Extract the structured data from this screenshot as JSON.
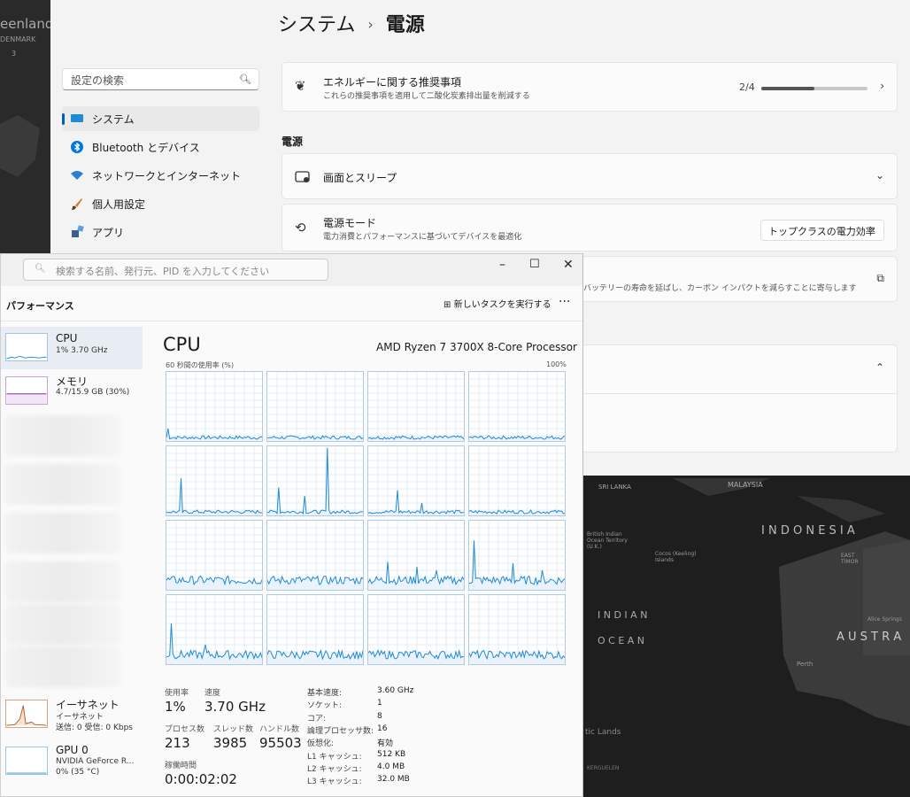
{
  "settings": {
    "breadcrumb_parent": "システム",
    "breadcrumb_current": "電源",
    "search_placeholder": "設定の検索",
    "nav": [
      {
        "label": "システム",
        "icon": "monitor-icon",
        "selected": true
      },
      {
        "label": "Bluetooth とデバイス",
        "icon": "bluetooth-icon"
      },
      {
        "label": "ネットワークとインターネット",
        "icon": "wifi-icon"
      },
      {
        "label": "個人用設定",
        "icon": "brush-icon"
      },
      {
        "label": "アプリ",
        "icon": "apps-icon"
      }
    ],
    "energy": {
      "title": "エネルギーに関する推奨事項",
      "subtitle": "これらの推奨事項を適用して二酸化炭素排出量を削減する",
      "progress_text": "2/4",
      "progress_fraction": 0.5
    },
    "section_title": "電源",
    "screen_sleep": "画面とスリープ",
    "power_mode": {
      "title": "電源モード",
      "subtitle": "電力消費とパフォーマンスに基づいてデバイスを最適化",
      "value": "トップクラスの電力効率"
    },
    "battery_text": "バッテリーの寿命を延ばし、カーボン インパクトを減らすことに寄与します"
  },
  "taskmanager": {
    "search_placeholder": "検索する名前、発行元、PID を入力してください",
    "header": "パフォーマンス",
    "new_task": "新しいタスクを実行する",
    "sidebar": [
      {
        "name": "CPU",
        "sub": "1%  3.70 GHz"
      },
      {
        "name": "メモリ",
        "sub": "4.7/15.9 GB (30%)"
      },
      {
        "name": "イーサネット",
        "sub": "イーサネット",
        "sub2": "送信: 0 受信: 0 Kbps"
      },
      {
        "name": "GPU 0",
        "sub": "NVIDIA GeForce R...",
        "sub2": "0% (35 °C)"
      }
    ],
    "cpu_title": "CPU",
    "cpu_name": "AMD Ryzen 7 3700X 8-Core Processor",
    "graph_label": "60 秒間の使用率 (%)",
    "graph_max": "100%",
    "graph_spikes": [
      [
        0.15,
        0.05,
        0.08,
        0.05,
        0.05,
        0.05,
        0.05,
        0.12,
        0.05,
        0.05,
        0.06,
        0.05
      ],
      [
        0.08,
        0.05,
        0.05,
        0.06,
        0.05,
        0.05,
        0.07,
        0.05,
        0.05,
        0.05,
        0.06,
        0.05
      ],
      [
        0.06,
        0.05,
        0.05,
        0.05,
        0.05,
        0.05,
        0.06,
        0.05,
        0.05,
        0.05,
        0.05,
        0.05
      ],
      [
        0.05,
        0.05,
        0.05,
        0.05,
        0.06,
        0.05,
        0.05,
        0.05,
        0.05,
        0.12,
        0.05,
        0.05
      ],
      [
        0.05,
        0.05,
        0.05,
        0.05,
        0.05,
        0.05,
        0.05,
        0.05,
        0.05,
        0.05,
        0.05,
        0.05
      ],
      [
        0.05,
        0.05,
        0.05,
        0.05,
        0.05,
        0.05,
        0.05,
        0.05,
        0.05,
        0.05,
        0.05,
        0.05
      ],
      [
        0.05,
        0.05,
        0.05,
        0.05,
        0.05,
        0.05,
        0.05,
        0.05,
        0.05,
        0.05,
        0.05,
        0.05
      ],
      [
        0.05,
        0.05,
        0.05,
        0.05,
        0.05,
        0.05,
        0.05,
        0.05,
        0.05,
        0.05,
        0.05,
        0.05
      ]
    ],
    "stats": {
      "usage_label": "使用率",
      "usage": "1%",
      "speed_label": "速度",
      "speed": "3.70 GHz",
      "proc_label": "プロセス数",
      "proc": "213",
      "thread_label": "スレッド数",
      "thread": "3985",
      "handle_label": "ハンドル数",
      "handle": "95503",
      "uptime_label": "稼働時間",
      "uptime": "0:00:02:02"
    },
    "info": [
      {
        "k": "基本速度:",
        "v": "3.60 GHz"
      },
      {
        "k": "ソケット:",
        "v": "1"
      },
      {
        "k": "コア:",
        "v": "8"
      },
      {
        "k": "論理プロセッサ数:",
        "v": "16"
      },
      {
        "k": "仮想化:",
        "v": "有効"
      },
      {
        "k": "L1 キャッシュ:",
        "v": "512 KB"
      },
      {
        "k": "L2 キャッシュ:",
        "v": "4.0 MB"
      },
      {
        "k": "L3 キャッシュ:",
        "v": "32.0 MB"
      }
    ]
  },
  "wallpaper": {
    "labels": [
      "eenland",
      "DENMARK",
      "3",
      "SRI LANKA",
      "MALAYSIA",
      "I N D O N E S I A",
      "British Indian Ocean Territory (U.K.)",
      "Cocos (Keeling) Islands",
      "EAST TIMOR",
      "I N D I A N",
      "O C E A N",
      "A U S T R A",
      "Perth",
      "Alice Springs",
      "tic Lands",
      "KERGUELEN"
    ]
  }
}
